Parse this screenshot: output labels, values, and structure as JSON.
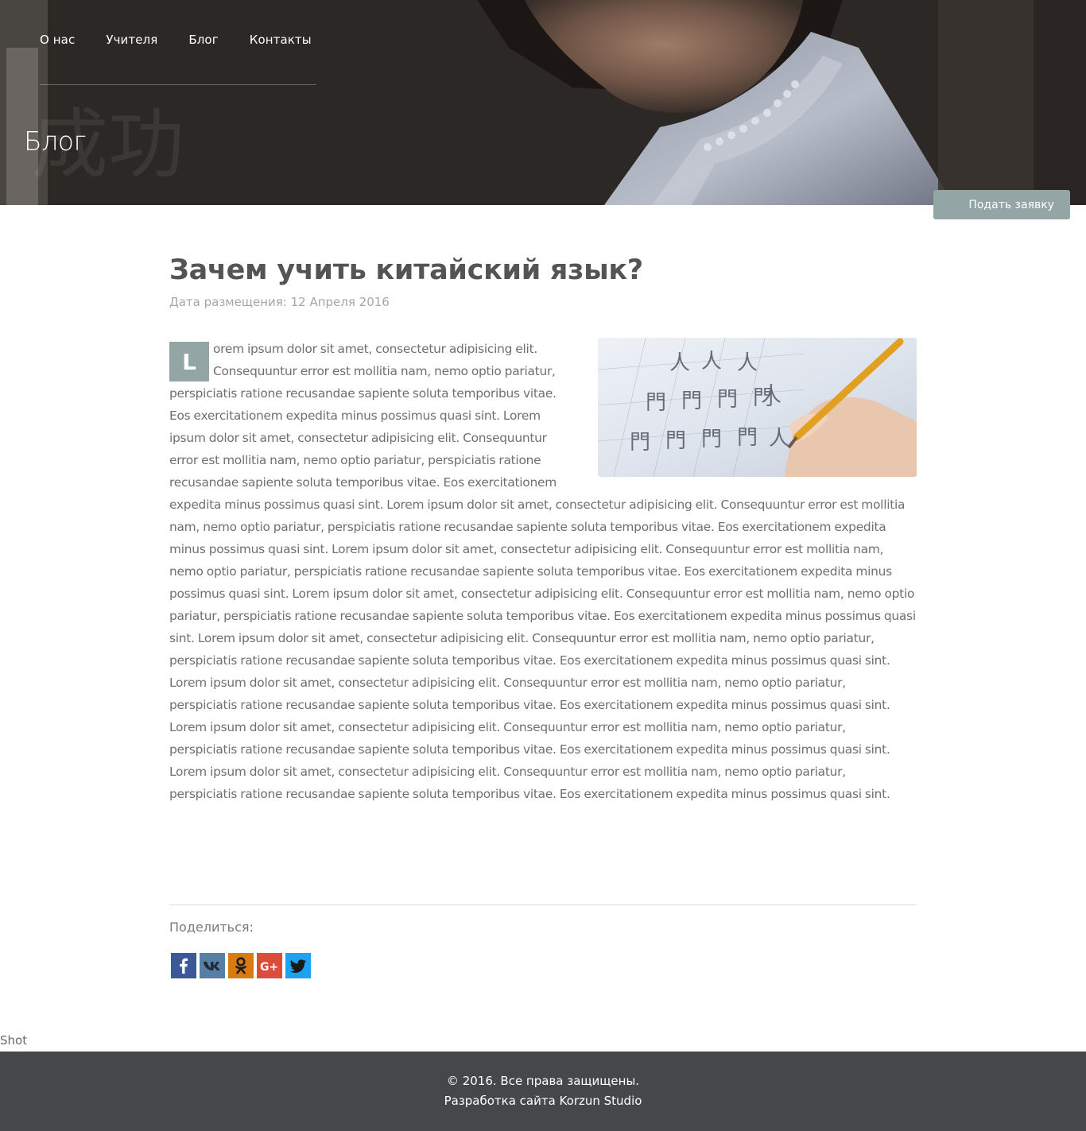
{
  "nav": {
    "items": [
      {
        "label": "О нас"
      },
      {
        "label": "Учителя"
      },
      {
        "label": "Блог"
      },
      {
        "label": "Контакты"
      }
    ]
  },
  "hero": {
    "title": "Блог",
    "apply_button": "Подать заявку"
  },
  "article": {
    "title": "Зачем учить китайский язык?",
    "date": "Дата размещения: 12 Апреля 2016",
    "dropcap": "L",
    "body": "orem ipsum dolor sit amet, consectetur adipisicing elit. Consequuntur error est mollitia nam, nemo optio pariatur, perspiciatis ratione recusandae sapiente soluta temporibus vitae. Eos exercitationem expedita minus possimus quasi sint. Lorem ipsum dolor sit amet, consectetur adipisicing elit. Consequuntur error est mollitia nam, nemo optio pariatur, perspiciatis ratione recusandae sapiente soluta temporibus vitae. Eos exercitationem expedita minus possimus quasi sint. Lorem ipsum dolor sit amet, consectetur adipisicing elit. Consequuntur error est mollitia nam, nemo optio pariatur, perspiciatis ratione recusandae sapiente soluta temporibus vitae. Eos exercitationem expedita minus possimus quasi sint. Lorem ipsum dolor sit amet, consectetur adipisicing elit. Consequuntur error est mollitia nam, nemo optio pariatur, perspiciatis ratione recusandae sapiente soluta temporibus vitae. Eos exercitationem expedita minus possimus quasi sint. Lorem ipsum dolor sit amet, consectetur adipisicing elit. Consequuntur error est mollitia nam, nemo optio pariatur, perspiciatis ratione recusandae sapiente soluta temporibus vitae. Eos exercitationem expedita minus possimus quasi sint. Lorem ipsum dolor sit amet, consectetur adipisicing elit. Consequuntur error est mollitia nam, nemo optio pariatur, perspiciatis ratione recusandae sapiente soluta temporibus vitae. Eos exercitationem expedita minus possimus quasi sint. Lorem ipsum dolor sit amet, consectetur adipisicing elit. Consequuntur error est mollitia nam, nemo optio pariatur, perspiciatis ratione recusandae sapiente soluta temporibus vitae. Eos exercitationem expedita minus possimus quasi sint. Lorem ipsum dolor sit amet, consectetur adipisicing elit. Consequuntur error est mollitia nam, nemo optio pariatur, perspiciatis ratione recusandae sapiente soluta temporibus vitae. Eos exercitationem expedita minus possimus quasi sint. Lorem ipsum dolor sit amet, consectetur adipisicing elit. Consequuntur error est mollitia nam, nemo optio pariatur, perspiciatis ratione recusandae sapiente soluta temporibus vitae. Eos exercitationem expedita minus possimus quasi sint."
  },
  "share": {
    "label": "Поделиться:",
    "buttons": [
      {
        "icon": "facebook-icon",
        "color": "#3b5998"
      },
      {
        "icon": "vk-icon",
        "color": "#587ea3"
      },
      {
        "icon": "odnoklassniki-icon",
        "color": "#ee8208"
      },
      {
        "icon": "google-plus-icon",
        "color": "#dd4b39"
      },
      {
        "icon": "twitter-icon",
        "color": "#1da1f2"
      }
    ]
  },
  "shot_text": "Shot",
  "footer": {
    "copyright": "© 2016. Все права защищены.",
    "credit": "Разработка сайта Korzun Studio"
  },
  "colors": {
    "accent": "#93a5a4",
    "footer_bg": "#464748",
    "title": "#545454",
    "text": "#6f6f6f"
  }
}
